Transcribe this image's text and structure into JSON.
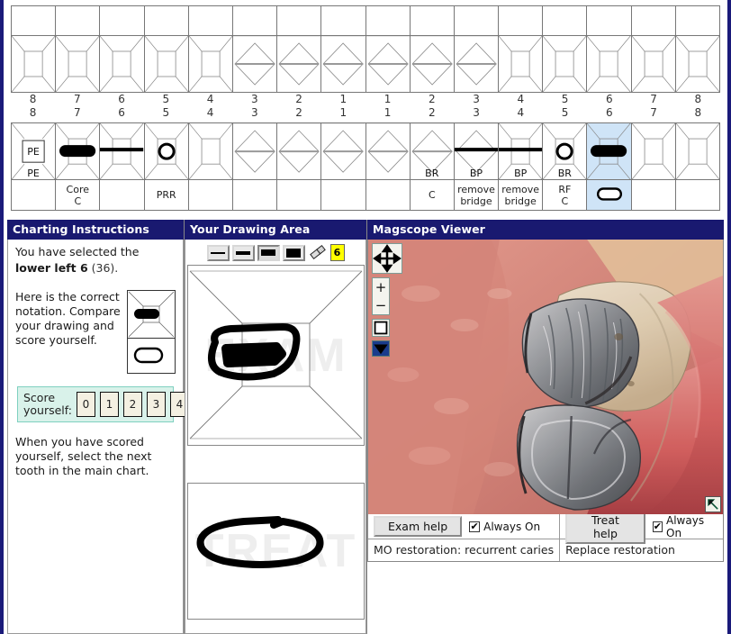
{
  "chart": {
    "upper": {
      "left_numbers": [
        "8",
        "7",
        "6",
        "5",
        "4",
        "3",
        "2",
        "1"
      ],
      "right_numbers": [
        "1",
        "2",
        "3",
        "4",
        "5",
        "6",
        "7",
        "8"
      ],
      "notes": [
        "",
        "",
        "",
        "",
        "",
        "",
        "",
        "",
        "",
        "",
        "",
        "",
        "",
        "",
        "",
        ""
      ]
    },
    "lower": {
      "left_numbers": [
        "8",
        "7",
        "6",
        "5",
        "4",
        "3",
        "2",
        "1"
      ],
      "right_numbers": [
        "1",
        "2",
        "3",
        "4",
        "5",
        "6",
        "7",
        "8"
      ],
      "surface_marks": [
        "PE",
        "",
        "",
        "",
        "",
        "",
        "",
        "",
        "",
        "BR",
        "BP",
        "BP",
        "BR",
        "",
        "",
        ""
      ],
      "notes": [
        "",
        "Core\nC",
        "",
        "PRR",
        "",
        "",
        "",
        "",
        "",
        "C",
        "remove\nbridge",
        "remove\nbridge",
        "RF\nC",
        "",
        "",
        ""
      ],
      "selected_index": 13,
      "selected_highlight_color": "#cfe4f7"
    }
  },
  "instructions": {
    "header": "Charting Instructions",
    "selected_prefix": "You have selected the",
    "selected_tooth": "lower left 6",
    "selected_notation": "(36).",
    "notation_text": "Here is the correct notation. Compare your drawing and score yourself.",
    "score_label": "Score yourself:",
    "score_options": [
      "0",
      "1",
      "2",
      "3",
      "4"
    ],
    "closing_text": "When you have scored yourself, select the next tooth in the main chart."
  },
  "drawing": {
    "header": "Your Drawing Area",
    "tools": [
      {
        "name": "line-width-1",
        "width": 1
      },
      {
        "name": "line-width-2",
        "width": 2
      },
      {
        "name": "line-width-3",
        "width": 3
      },
      {
        "name": "line-width-4",
        "width": 4
      }
    ],
    "selected_tool_index": 2,
    "eraser_icon": "eraser-icon",
    "counter_value": "6",
    "counter_color": "#ffff00",
    "watermark_exam": "EXAM",
    "watermark_treat": "TREAT"
  },
  "viewer": {
    "header": "Magscope Viewer",
    "controls": {
      "pan": "pan-icon",
      "zoom_in": "+",
      "zoom_out": "−",
      "fit": "fit-icon",
      "dropdown": "chevron-down-icon"
    },
    "resize_handle": "resize-handle-icon",
    "exam_button": "Exam help",
    "exam_always_on": "Always On",
    "exam_always_on_checked": true,
    "exam_finding": "MO restoration: recurrent caries",
    "treat_button": "Treat help",
    "treat_always_on": "Always On",
    "treat_always_on_checked": true,
    "treat_finding": "Replace restoration"
  },
  "colors": {
    "header_bg": "#191970",
    "selected_tooth": "#cfe4f7",
    "score_panel": "#d9f2ea",
    "badge": "#ffff00"
  }
}
